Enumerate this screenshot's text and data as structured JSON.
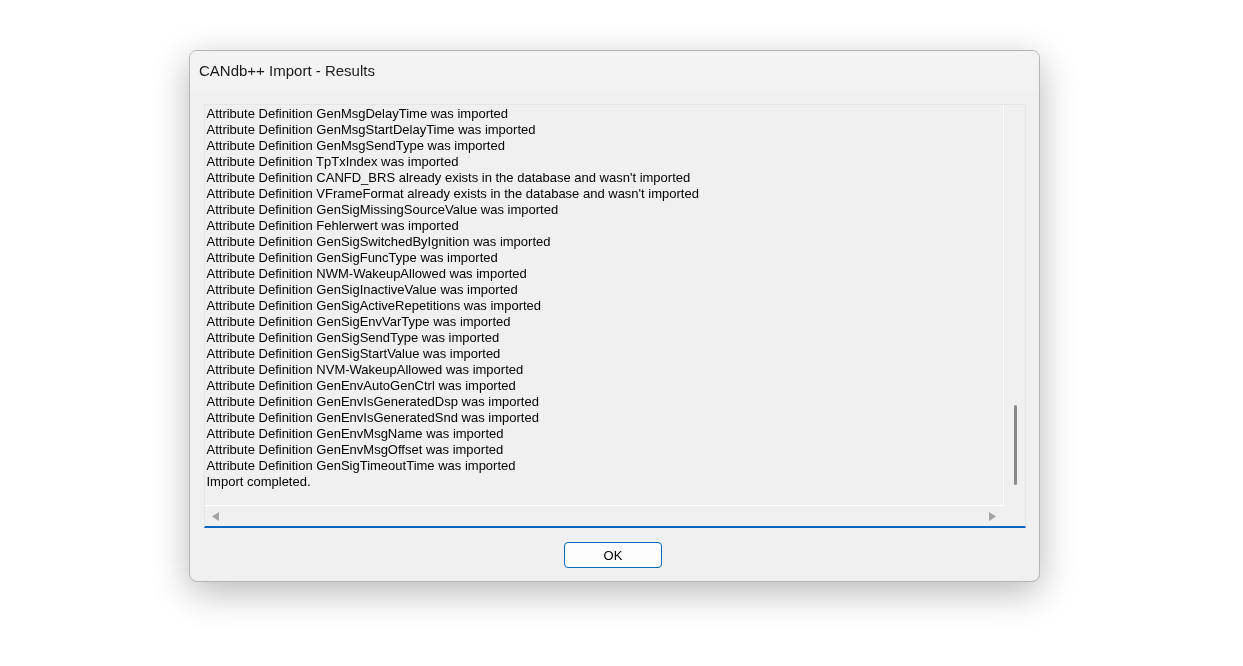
{
  "window": {
    "title": "CANdb++ Import - Results"
  },
  "log": {
    "focused": true,
    "lines": [
      "Attribute Definition GenMsgDelayTime was imported",
      "Attribute Definition GenMsgStartDelayTime was imported",
      "Attribute Definition GenMsgSendType was imported",
      "Attribute Definition TpTxIndex was imported",
      "Attribute Definition CANFD_BRS already exists in the database and wasn't imported",
      "Attribute Definition VFrameFormat already exists in the database and wasn't imported",
      "Attribute Definition GenSigMissingSourceValue was imported",
      "Attribute Definition Fehlerwert was imported",
      "Attribute Definition GenSigSwitchedByIgnition was imported",
      "Attribute Definition GenSigFuncType was imported",
      "Attribute Definition NWM-WakeupAllowed was imported",
      "Attribute Definition GenSigInactiveValue was imported",
      "Attribute Definition GenSigActiveRepetitions was imported",
      "Attribute Definition GenSigEnvVarType was imported",
      "Attribute Definition GenSigSendType was imported",
      "Attribute Definition GenSigStartValue was imported",
      "Attribute Definition NVM-WakeupAllowed was imported",
      "Attribute Definition GenEnvAutoGenCtrl was imported",
      "Attribute Definition GenEnvIsGeneratedDsp was imported",
      "Attribute Definition GenEnvIsGeneratedSnd was imported",
      "Attribute Definition GenEnvMsgName was imported",
      "Attribute Definition GenEnvMsgOffset was imported",
      "Attribute Definition GenSigTimeoutTime was imported",
      "Import completed."
    ]
  },
  "buttons": [
    {
      "label": "OK",
      "default": true
    }
  ]
}
